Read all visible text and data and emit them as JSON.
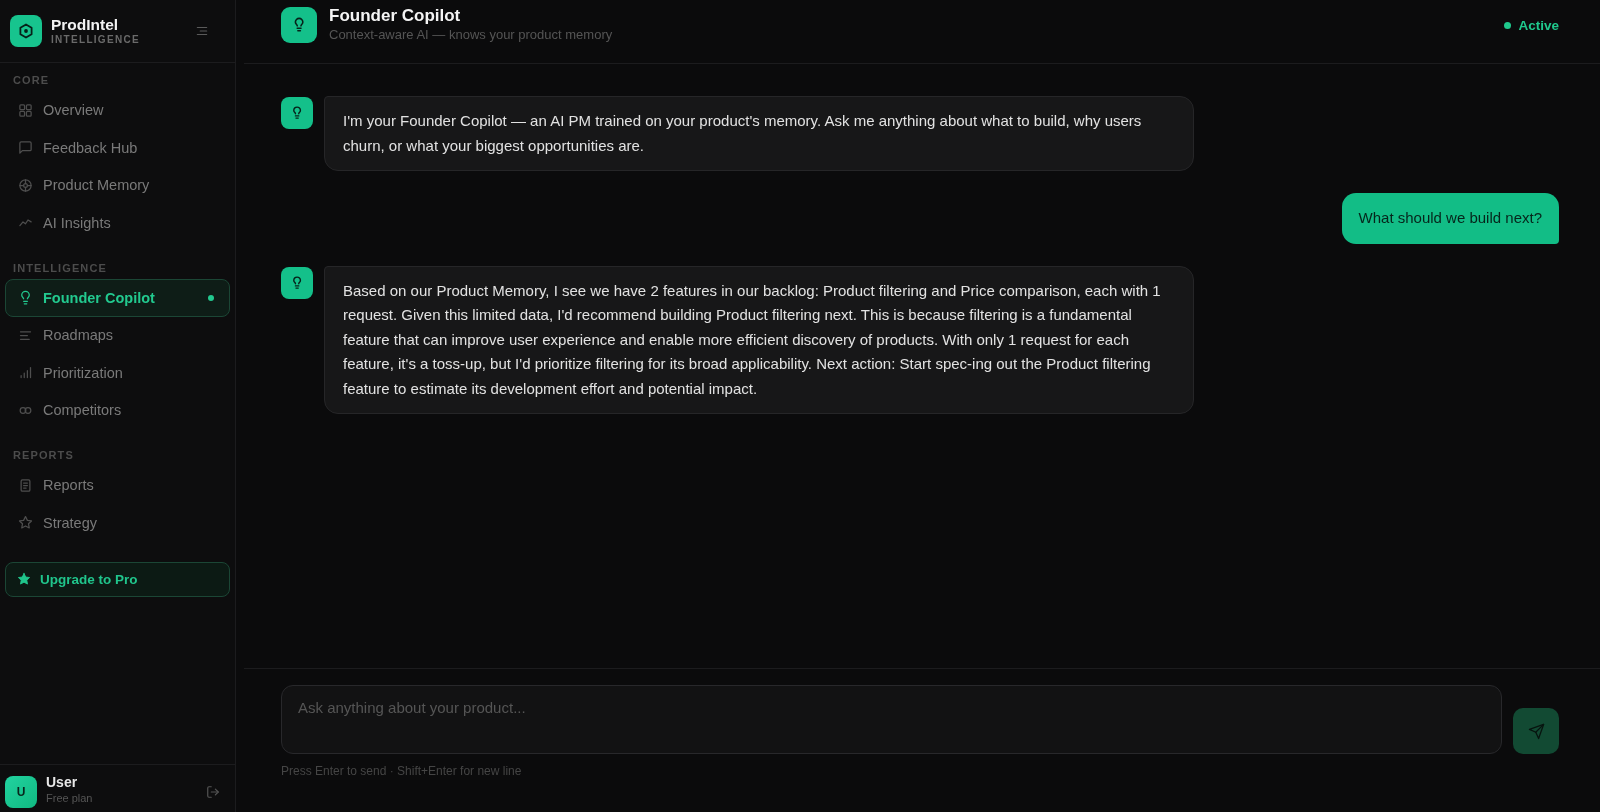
{
  "sidebar": {
    "brand": {
      "name": "ProdIntel",
      "tagline": "INTELLIGENCE"
    },
    "sections": [
      {
        "label": "CORE",
        "items": [
          {
            "label": "Overview",
            "selected": false
          },
          {
            "label": "Feedback Hub",
            "selected": false
          },
          {
            "label": "Product Memory",
            "selected": false
          },
          {
            "label": "AI Insights",
            "selected": false
          }
        ]
      },
      {
        "label": "INTELLIGENCE",
        "items": [
          {
            "label": "Founder Copilot",
            "selected": true
          },
          {
            "label": "Roadmaps",
            "selected": false
          },
          {
            "label": "Prioritization",
            "selected": false
          },
          {
            "label": "Competitors",
            "selected": false
          }
        ]
      },
      {
        "label": "REPORTS",
        "items": [
          {
            "label": "Reports",
            "selected": false
          },
          {
            "label": "Strategy",
            "selected": false
          }
        ]
      }
    ],
    "upgrade_button": "Upgrade to Pro",
    "user": {
      "initial": "U",
      "name": "User",
      "plan": "Free plan"
    }
  },
  "header": {
    "title": "Founder Copilot",
    "subtitle": "Context-aware AI — knows your product memory",
    "status": "Active"
  },
  "messages": [
    {
      "kind": "assistant",
      "text": "I'm your Founder Copilot — an AI PM trained on your product's memory. Ask me anything about what to build, why users churn, or what your biggest opportunities are."
    },
    {
      "kind": "user",
      "text": "What should we build next?"
    },
    {
      "kind": "assistant",
      "text": "Based on our Product Memory, I see we have 2 features in our backlog: Product filtering and Price comparison, each with 1 request. Given this limited data, I'd recommend building Product filtering next. This is because filtering is a fundamental feature that can improve user experience and enable more efficient discovery of products. With only 1 request for each feature, it's a toss-up, but I'd prioritize filtering for its broad applicability. Next action: Start spec-ing out the Product filtering feature to estimate its development effort and potential impact."
    }
  ],
  "composer": {
    "placeholder": "Ask anything about your product...",
    "send_button": {
      "disabled": true
    },
    "hint": "Press Enter to send · Shift+Enter for new line"
  }
}
